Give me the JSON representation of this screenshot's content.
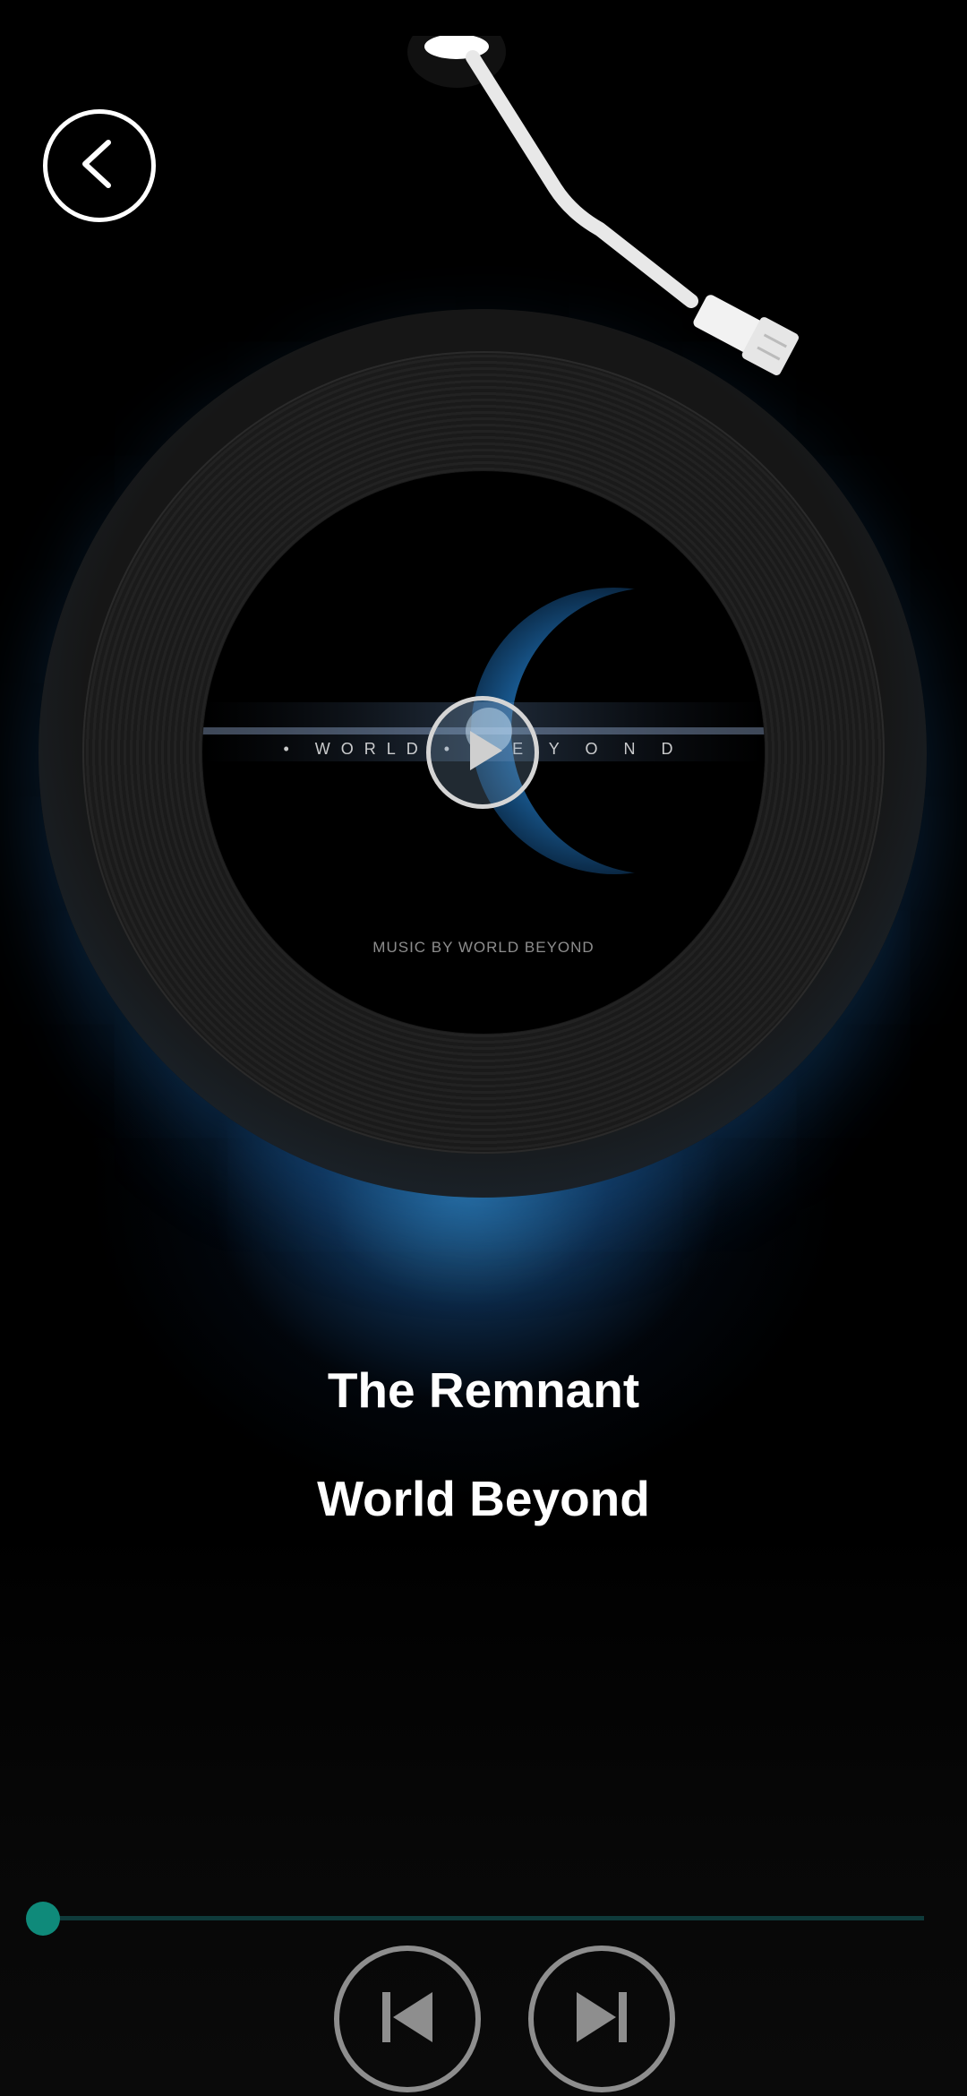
{
  "player": {
    "track_title": "The Remnant",
    "artist": "World Beyond",
    "progress": 0.0
  },
  "album_art": {
    "title_text": "• WORLD • B E Y O N D",
    "credit_text": "MUSIC BY WORLD BEYOND"
  },
  "icons": {
    "back": "chevron-left-icon",
    "play": "play-icon",
    "previous": "skip-previous-icon",
    "next": "skip-next-icon"
  },
  "colors": {
    "accent": "#0f8a7a",
    "progress_track": "#0f3a3a",
    "glow": "#348ecd",
    "text": "#ffffff",
    "control_ring": "#8e8e8e"
  }
}
